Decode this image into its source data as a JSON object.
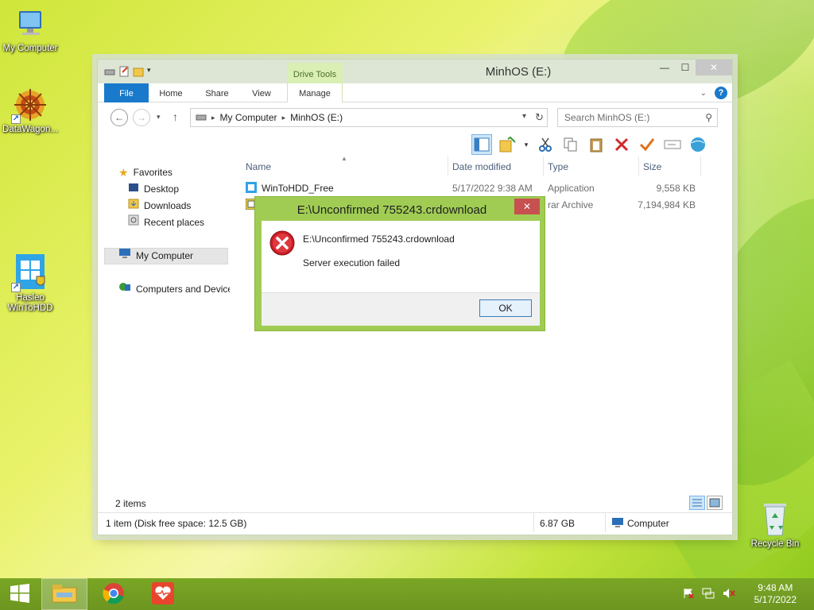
{
  "desktop": {
    "icons": [
      {
        "label": "My Computer"
      },
      {
        "label": "DataWagon..."
      },
      {
        "label": "Hasleo WinToHDD"
      },
      {
        "label": "Recycle Bin"
      }
    ]
  },
  "window": {
    "title": "MinhOS (E:)",
    "context_tab_group": "Drive Tools",
    "tabs": [
      "File",
      "Home",
      "Share",
      "View",
      "Manage"
    ],
    "address": {
      "crumbs": [
        "My Computer",
        "MinhOS (E:)"
      ]
    },
    "search": {
      "placeholder": "Search MinhOS (E:)"
    },
    "nav": {
      "favorites": "Favorites",
      "desktop": "Desktop",
      "downloads": "Downloads",
      "recent": "Recent places",
      "computer": "My Computer",
      "network": "Computers and Devices"
    },
    "columns": [
      "Name",
      "Date modified",
      "Type",
      "Size"
    ],
    "files": [
      {
        "name": "WinToHDD_Free",
        "date": "5/17/2022 9:38 AM",
        "type": "Application",
        "size": "9,558 KB"
      },
      {
        "name": "",
        "date": "",
        "type": "rar Archive",
        "size": "7,194,984 KB"
      }
    ],
    "status": {
      "items": "2 items",
      "selection": "1 item (Disk free space: 12.5 GB)",
      "size": "6.87 GB",
      "location": "Computer"
    }
  },
  "dialog": {
    "title": "E:\\Unconfirmed 755243.crdownload",
    "message_path": "E:\\Unconfirmed 755243.crdownload",
    "message": "Server execution failed",
    "ok": "OK"
  },
  "taskbar": {
    "time": "9:48 AM",
    "date": "5/17/2022"
  },
  "colors": {
    "accent": "#1979ca",
    "dialog_frame": "#a0cc54",
    "taskbar": "#6c9620",
    "error": "#c81e28"
  }
}
